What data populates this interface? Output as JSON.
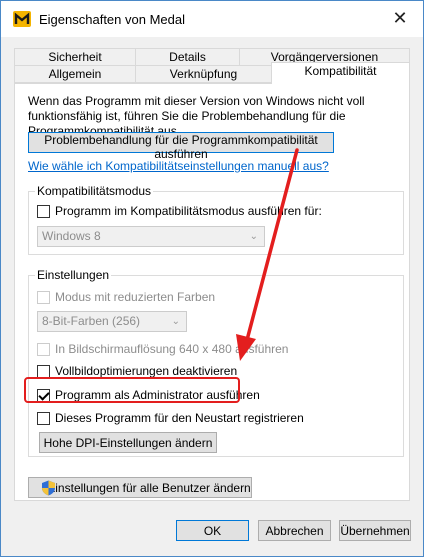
{
  "window": {
    "title": "Eigenschaften von Medal",
    "app_icon": "medal-app-icon",
    "close_glyph": "✕"
  },
  "tabs": {
    "row1": [
      {
        "label": "Sicherheit"
      },
      {
        "label": "Details"
      },
      {
        "label": "Vorgängerversionen"
      }
    ],
    "row2": [
      {
        "label": "Allgemein"
      },
      {
        "label": "Verknüpfung"
      },
      {
        "label": "Kompatibilität",
        "active": true
      }
    ]
  },
  "panel": {
    "description": "Wenn das Programm mit dieser Version von Windows nicht voll funktionsfähig ist, führen Sie die Problembehandlung für die Programmkompatibilität aus.",
    "troubleshoot_button": "Problembehandlung für die Programmkompatibilität ausführen",
    "manual_link": "Wie wähle ich Kompatibilitätseinstellungen manuell aus?"
  },
  "compat_mode": {
    "title": "Kompatibilitätsmodus",
    "checkbox_label": "Programm im Kompatibilitätsmodus ausführen für:",
    "checked": false,
    "select_value": "Windows 8"
  },
  "settings": {
    "title": "Einstellungen",
    "reduced_colors_label": "Modus mit reduzierten Farben",
    "color_select_value": "8-Bit-Farben (256)",
    "resolution_label": "In Bildschirmauflösung 640 x 480 ausführen",
    "fullscreen_opt_label": "Vollbildoptimierungen deaktivieren",
    "run_as_admin_label": "Programm als Administrator ausführen",
    "run_as_admin_checked": true,
    "restart_register_label": "Dieses Programm für den Neustart registrieren",
    "dpi_button": "Hohe DPI-Einstellungen ändern"
  },
  "all_users_button": "Einstellungen für alle Benutzer ändern",
  "footer": {
    "ok": "OK",
    "cancel": "Abbrechen",
    "apply": "Übernehmen"
  },
  "colors": {
    "highlight": "#e31e1e",
    "link": "#0066cc",
    "focus_border": "#0078d7"
  }
}
